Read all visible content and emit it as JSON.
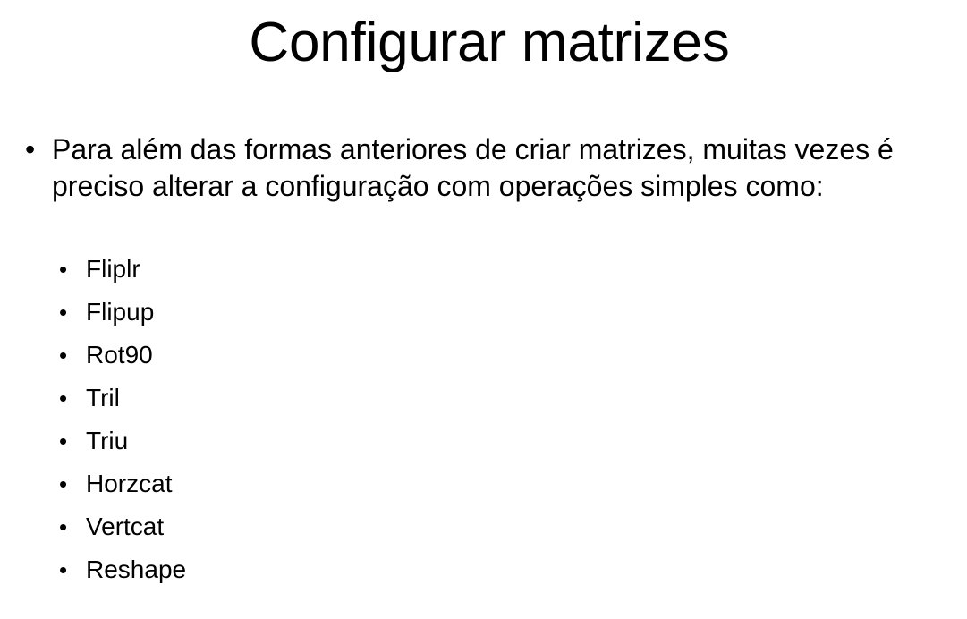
{
  "slide": {
    "title": "Configurar matrizes",
    "bullet": {
      "marker": "•",
      "text": "Para além das formas anteriores de criar matrizes, muitas vezes é preciso alterar a configuração com operações simples como:"
    },
    "sub_items": [
      {
        "marker": "•",
        "label": "Fliplr"
      },
      {
        "marker": "•",
        "label": "Flipup"
      },
      {
        "marker": "•",
        "label": "Rot90"
      },
      {
        "marker": "•",
        "label": "Tril"
      },
      {
        "marker": "•",
        "label": "Triu"
      },
      {
        "marker": "•",
        "label": "Horzcat"
      },
      {
        "marker": "•",
        "label": "Vertcat"
      },
      {
        "marker": "•",
        "label": "Reshape"
      }
    ]
  }
}
